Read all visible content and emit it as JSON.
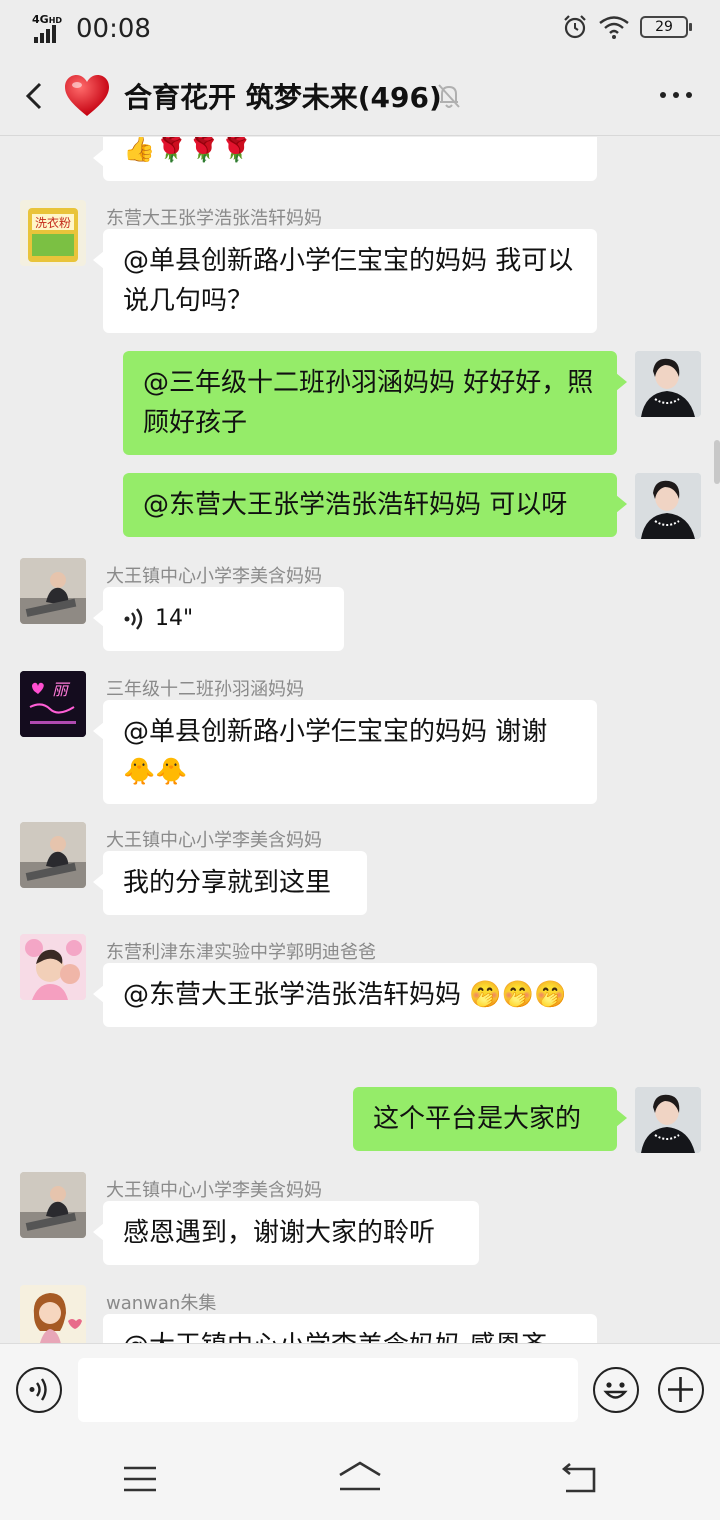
{
  "status": {
    "network": "4G",
    "network_sup": "HD",
    "time": "00:08",
    "battery": "29"
  },
  "header": {
    "title": "合育花开 筑梦未来(496)"
  },
  "messages": {
    "m0": {
      "emoji": "👍🌹🌹🌹"
    },
    "m1": {
      "sender": "东营大王张学浩张浩轩妈妈",
      "text": "@单县创新路小学仨宝宝的妈妈  我可以说几句吗？"
    },
    "m2": {
      "text": "@三年级十二班孙羽涵妈妈  好好好，照顾好孩子"
    },
    "m3": {
      "text": "@东营大王张学浩张浩轩妈妈  可以呀"
    },
    "m4": {
      "sender": "大王镇中心小学李美含妈妈",
      "voice": "14\""
    },
    "m5": {
      "sender": "三年级十二班孙羽涵妈妈",
      "text": "@单县创新路小学仨宝宝的妈妈  谢谢",
      "emoji": "🐥🐥"
    },
    "m6": {
      "sender": "大王镇中心小学李美含妈妈",
      "text": "我的分享就到这里"
    },
    "m7": {
      "sender": "东营利津东津实验中学郭明迪爸爸",
      "text": "@东营大王张学浩张浩轩妈妈  ",
      "emoji": "🤭🤭🤭"
    },
    "m8": {
      "text": "这个平台是大家的"
    },
    "m9": {
      "sender": "大王镇中心小学李美含妈妈",
      "text": "感恩遇到，谢谢大家的聆听"
    },
    "m10": {
      "sender": "wanwan朱集",
      "text": "@大王镇中心小学李美含妈妈  感恩齐"
    }
  },
  "avatars": {
    "a1": "洗衣粉",
    "a5": "丽"
  },
  "input": {
    "placeholder": ""
  },
  "colors": {
    "background": "#ededed",
    "bubble_self": "#95ec69",
    "bubble_other": "#ffffff",
    "sender_name": "#8a8a8a"
  },
  "icons": {
    "back": "chevron-left-icon",
    "group": "heart-icon",
    "mute": "bell-off-icon",
    "more": "more-dots-icon",
    "voice": "voice-icon",
    "emoji": "smiley-icon",
    "plus": "plus-icon",
    "nav_menu": "menu-icon",
    "nav_home": "home-icon",
    "nav_back": "return-icon"
  }
}
